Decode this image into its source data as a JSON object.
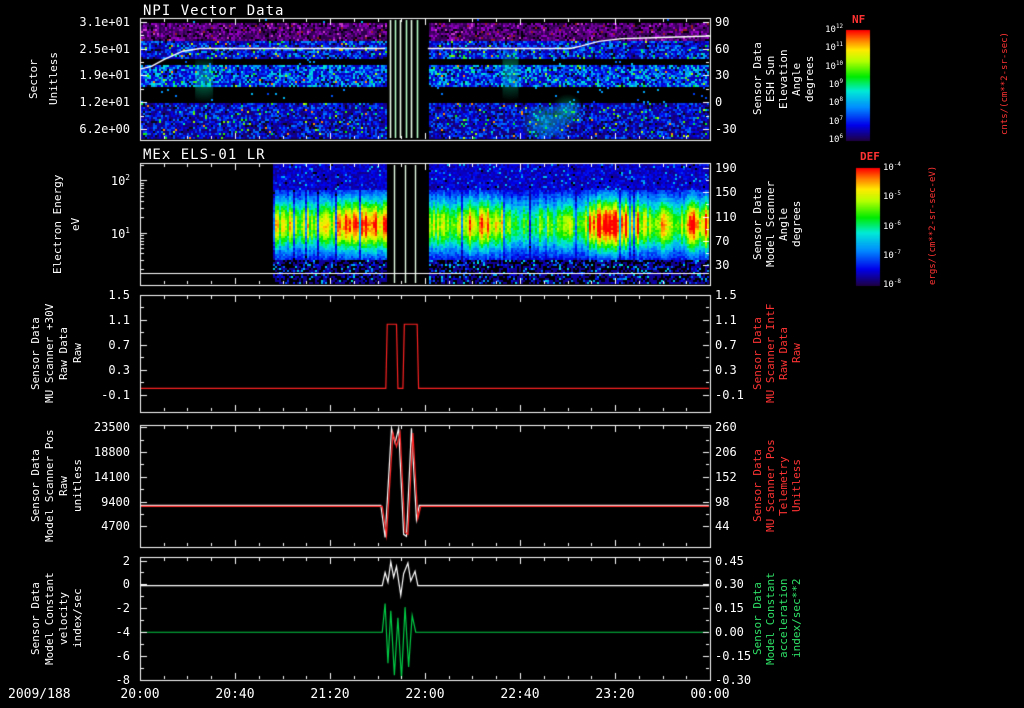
{
  "app": {
    "background": "#000000"
  },
  "chart_data": {
    "type": "multi-panel-time-series",
    "x_axis": {
      "date_label": "2009/188",
      "tick_labels": [
        "20:00",
        "20:40",
        "21:20",
        "22:00",
        "22:40",
        "23:20",
        "00:00"
      ],
      "start_hour": 20,
      "end_hour": 24,
      "minor_tick_minutes": 10
    },
    "panels": [
      {
        "kind": "spectrogram",
        "title": "NPI Vector Data",
        "left_axis": {
          "label_columns": [
            "Sector",
            "Unitless"
          ],
          "ticks": [
            "3.1e+01",
            "2.5e+01",
            "1.9e+01",
            "1.2e+01",
            "6.2e+00"
          ],
          "color": "#ffffff"
        },
        "right_axis": {
          "label_columns": [
            "Sensor Data",
            "ESH Sun",
            "Elevation",
            "Angle",
            "degrees"
          ],
          "ticks": [
            "90",
            "60",
            "30",
            "0",
            "-30"
          ],
          "range": [
            -42,
            94
          ],
          "color": "#ffffff"
        },
        "overlay_line": {
          "color": "#ffffff",
          "axis": "right",
          "points": [
            [
              20.0,
              37
            ],
            [
              20.08,
              40
            ],
            [
              20.17,
              48
            ],
            [
              20.3,
              57
            ],
            [
              20.42,
              60
            ],
            [
              23.02,
              60
            ],
            [
              23.1,
              63
            ],
            [
              23.22,
              68
            ],
            [
              23.38,
              71
            ],
            [
              23.6,
              72
            ],
            [
              24.0,
              74
            ]
          ]
        },
        "spectrogram": {
          "x_start_hour": 20.0,
          "black_bands_frac": [
            [
              0.0,
              0.03
            ],
            [
              0.33,
              0.375
            ],
            [
              0.555,
              0.695
            ]
          ],
          "magenta_band_frac": [
            0.03,
            0.185
          ],
          "gap_hours": [
            21.72,
            22.02
          ],
          "stripe_hours": [
            21.755,
            21.79,
            21.825,
            21.865,
            21.9,
            21.945
          ]
        }
      },
      {
        "kind": "spectrogram",
        "title": "MEx ELS-01 LR",
        "left_axis": {
          "label_columns": [
            "Electron Energy",
            "eV"
          ],
          "tick_base": "10",
          "log_tick_exponents": [
            "2",
            "1"
          ],
          "color": "#ffffff"
        },
        "right_axis": {
          "label_columns": [
            "Sensor Data",
            "Model Scanner",
            "Angle",
            "degrees"
          ],
          "ticks": [
            "190",
            "150",
            "110",
            "70",
            "30"
          ],
          "color": "#ffffff"
        },
        "overlay_hline_frac": 0.9,
        "spectrogram": {
          "x_start_hour": 20.93,
          "band_center_frac": 0.5,
          "band_width_frac": 0.16,
          "intensity_segments": [
            [
              20.93,
              21.35,
              0.7
            ],
            [
              21.35,
              21.72,
              0.82
            ],
            [
              22.02,
              22.3,
              0.66
            ],
            [
              22.3,
              22.55,
              0.76
            ],
            [
              22.55,
              22.95,
              0.55
            ],
            [
              22.95,
              23.15,
              0.66
            ],
            [
              23.15,
              23.5,
              0.95
            ],
            [
              23.5,
              23.85,
              0.7
            ],
            [
              23.85,
              24.0,
              0.85
            ]
          ],
          "gap_hours": [
            21.72,
            22.02
          ],
          "stripe_hours": [
            21.78,
            21.86,
            21.93
          ]
        }
      },
      {
        "kind": "line",
        "left_axis": {
          "label_columns": [
            "Sensor Data",
            "MU Scanner +30V",
            "Raw Data",
            "Raw"
          ],
          "ticks": [
            "1.5",
            "1.1",
            "0.7",
            "0.3",
            "-0.1"
          ],
          "color": "#ffffff"
        },
        "right_axis": {
          "label_columns": [
            "Sensor Data",
            "MU Scanner IntF",
            "Raw Data",
            "Raw"
          ],
          "ticks": [
            "1.5",
            "1.1",
            "0.7",
            "0.3",
            "-0.1"
          ],
          "color": "#ff3333"
        },
        "y_range": [
          -0.38,
          1.5
        ],
        "series": [
          {
            "name": "MU Scanner +30V Raw",
            "color": "#ff2222",
            "points": [
              [
                20.0,
                0.0
              ],
              [
                21.725,
                0.0
              ],
              [
                21.735,
                1.03
              ],
              [
                21.8,
                1.03
              ],
              [
                21.81,
                0.0
              ],
              [
                21.845,
                0.0
              ],
              [
                21.855,
                1.03
              ],
              [
                21.945,
                1.03
              ],
              [
                21.955,
                0.0
              ],
              [
                24.0,
                0.0
              ]
            ]
          }
        ]
      },
      {
        "kind": "line",
        "left_axis": {
          "label_columns": [
            "Sensor Data",
            "Model Scanner Pos",
            "Raw",
            "unitless"
          ],
          "ticks": [
            "23500",
            "18800",
            "14100",
            "9400",
            "4700"
          ],
          "color": "#ffffff"
        },
        "right_axis": {
          "label_columns": [
            "Sensor Data",
            "MU Scanner Pos",
            "Telemetry",
            "Unitless"
          ],
          "ticks": [
            "260",
            "206",
            "152",
            "98",
            "44"
          ],
          "color": "#ff3333"
        },
        "y_range": [
          800,
          23900
        ],
        "series": [
          {
            "name": "Model Scanner Pos Raw",
            "color": "#ffffff",
            "points": [
              [
                20.0,
                8700
              ],
              [
                21.69,
                8700
              ],
              [
                21.72,
                2600
              ],
              [
                21.765,
                23300
              ],
              [
                21.79,
                20500
              ],
              [
                21.815,
                23300
              ],
              [
                21.85,
                3200
              ],
              [
                21.87,
                2800
              ],
              [
                21.905,
                23300
              ],
              [
                21.94,
                6000
              ],
              [
                21.96,
                8700
              ],
              [
                24.0,
                8700
              ]
            ]
          },
          {
            "name": "MU Scanner Pos Telemetry",
            "color": "#ff2222",
            "points": [
              [
                20.0,
                8500
              ],
              [
                21.7,
                8500
              ],
              [
                21.73,
                3000
              ],
              [
                21.775,
                22400
              ],
              [
                21.8,
                19800
              ],
              [
                21.825,
                22400
              ],
              [
                21.86,
                3600
              ],
              [
                21.88,
                3200
              ],
              [
                21.915,
                22400
              ],
              [
                21.95,
                6200
              ],
              [
                21.97,
                8500
              ],
              [
                24.0,
                8500
              ]
            ]
          }
        ]
      },
      {
        "kind": "line",
        "left_axis": {
          "label_columns": [
            "Sensor Data",
            "Model Constant",
            "velocity",
            "index/sec"
          ],
          "ticks": [
            "2",
            "0",
            "-2",
            "-4",
            "-6",
            "-8"
          ],
          "color": "#ffffff"
        },
        "right_axis": {
          "label_columns": [
            "Sensor Data",
            "Model Constant",
            "acceleration",
            "index/sec**2"
          ],
          "ticks": [
            "0.45",
            "0.30",
            "0.15",
            "0.00",
            "-0.15",
            "-0.30"
          ],
          "color": "#2ee066"
        },
        "y_range": [
          -8,
          2.3
        ],
        "series": [
          {
            "name": "Model Constant velocity",
            "color": "#ffffff",
            "points": [
              [
                20.0,
                -0.1
              ],
              [
                21.7,
                -0.1
              ],
              [
                21.72,
                1.0
              ],
              [
                21.74,
                0.2
              ],
              [
                21.76,
                1.9
              ],
              [
                21.78,
                0.6
              ],
              [
                21.8,
                1.5
              ],
              [
                21.83,
                -0.9
              ],
              [
                21.85,
                0.9
              ],
              [
                21.88,
                1.8
              ],
              [
                21.9,
                0.3
              ],
              [
                21.93,
                1.1
              ],
              [
                21.95,
                -0.1
              ],
              [
                24.0,
                -0.1
              ]
            ]
          },
          {
            "name": "Model Constant acceleration",
            "color": "#00cc44",
            "points": [
              [
                20.0,
                -4.0
              ],
              [
                21.7,
                -4.0
              ],
              [
                21.72,
                -1.6
              ],
              [
                21.74,
                -6.6
              ],
              [
                21.76,
                -2.2
              ],
              [
                21.785,
                -7.6
              ],
              [
                21.81,
                -2.8
              ],
              [
                21.835,
                -7.9
              ],
              [
                21.86,
                -1.9
              ],
              [
                21.885,
                -6.9
              ],
              [
                21.91,
                -2.6
              ],
              [
                21.935,
                -4.0
              ],
              [
                24.0,
                -4.0
              ]
            ]
          }
        ]
      }
    ],
    "colorbars": [
      {
        "title": "NF",
        "title_color": "#ff3333",
        "unit": "cnts/(cm**2-sr-sec)",
        "tick_base": "10",
        "tick_exponents": [
          "12",
          "11",
          "10",
          "9",
          "8",
          "7",
          "6"
        ],
        "labels_side": "left"
      },
      {
        "title": "DEF",
        "title_color": "#ff3333",
        "unit": "ergs/(cm**2-sr-sec-eV)",
        "tick_base": "10",
        "tick_exponents": [
          "-4",
          "-5",
          "-6",
          "-7",
          "-8"
        ],
        "labels_side": "right"
      }
    ]
  }
}
